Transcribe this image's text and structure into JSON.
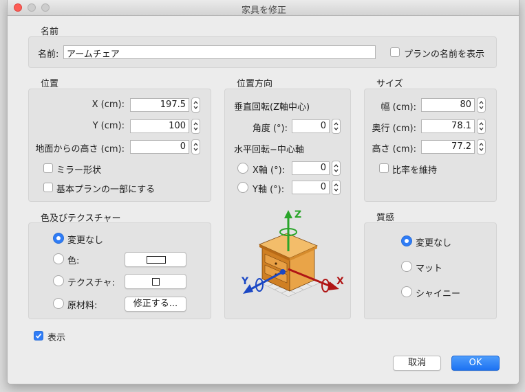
{
  "window": {
    "title": "家具を修正"
  },
  "name_section": {
    "title": "名前",
    "field_label": "名前:",
    "field_value": "アームチェア",
    "show_name_label": "プランの名前を表示",
    "show_name_checked": false
  },
  "position": {
    "title": "位置",
    "x_label": "X (cm):",
    "x_value": "197.5",
    "y_label": "Y (cm):",
    "y_value": "100",
    "elevation_label": "地面からの高さ (cm):",
    "elevation_value": "0",
    "mirror_label": "ミラー形状",
    "base_plan_label": "基本プランの一部にする"
  },
  "orientation": {
    "title": "位置方向",
    "vertical_heading": "垂直回転(Z軸中心)",
    "angle_label": "角度 (°):",
    "angle_value": "0",
    "horizontal_heading": "水平回転−中心軸",
    "x_axis_label": "X軸 (°):",
    "x_axis_value": "0",
    "y_axis_label": "Y軸 (°):",
    "y_axis_value": "0",
    "axis_z": "Z",
    "axis_x": "X",
    "axis_y": "Y"
  },
  "size": {
    "title": "サイズ",
    "width_label": "幅 (cm):",
    "width_value": "80",
    "depth_label": "奥行 (cm):",
    "depth_value": "78.1",
    "height_label": "高さ (cm):",
    "height_value": "77.2",
    "keep_ratio_label": "比率を維持"
  },
  "color_texture": {
    "title": "色及びテクスチャー",
    "unchanged_label": "変更なし",
    "color_label": "色:",
    "texture_label": "テクスチャ:",
    "materials_label": "原材料:",
    "modify_button": "修正する..."
  },
  "shininess": {
    "title": "質感",
    "unchanged_label": "変更なし",
    "matt_label": "マット",
    "shiny_label": "シャイニー"
  },
  "visible_label": "表示",
  "buttons": {
    "cancel": "取消",
    "ok": "OK"
  },
  "colors": {
    "accent": "#2f7cf6",
    "axis_z": "#2aa52a",
    "axis_x": "#b01515",
    "axis_y": "#1a47c4"
  }
}
